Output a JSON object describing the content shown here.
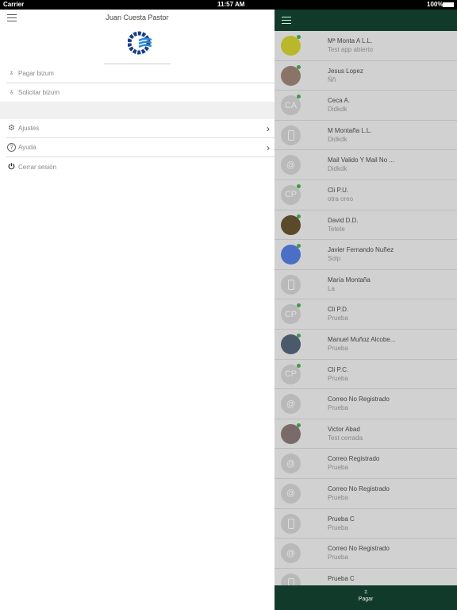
{
  "status": {
    "carrier": "Carrier",
    "time": "11:57 AM",
    "battery": "100%"
  },
  "menu": {
    "user_name": "Juan Cuesta Pastor",
    "items": [
      {
        "label": "Pagar bizum",
        "icon": "piggy-bank-icon"
      },
      {
        "label": "Solicitar bizum",
        "icon": "piggy-bank-icon"
      },
      {
        "label": "Ajustes",
        "icon": "gear-icon"
      },
      {
        "label": "Ayuda",
        "icon": "help-icon"
      },
      {
        "label": "Cerrar sesión",
        "icon": "power-icon"
      }
    ]
  },
  "colors": {
    "header": "#113a2b",
    "online": "#3d9a4a",
    "list_bg": "#d1d1d1"
  },
  "contacts": [
    {
      "name": "Mª Monta A L.L.",
      "sub": "Test app abierto",
      "avatar": "photo",
      "color": "#b8b82a",
      "online": true
    },
    {
      "name": "Jesus Lopez",
      "sub": "Ññ",
      "avatar": "photo",
      "color": "#8a7468",
      "online": true
    },
    {
      "name": "Ceca A.",
      "sub": "Didkdk",
      "avatar": "CA",
      "online": true
    },
    {
      "name": "M Montaña L.L.",
      "sub": "Didkdk",
      "avatar": "phone",
      "online": false
    },
    {
      "name": "Mail Valido Y Mail No ...",
      "sub": "Didkdk",
      "avatar": "@",
      "online": false
    },
    {
      "name": "Cli P.U.",
      "sub": "otra oreo",
      "avatar": "CP",
      "online": true
    },
    {
      "name": "David D.D.",
      "sub": "Tetete",
      "avatar": "photo",
      "color": "#5a4a2a",
      "online": true
    },
    {
      "name": "Javier Fernando Nuñez",
      "sub": "Solp",
      "avatar": "photo",
      "color": "#4a6fc4",
      "online": true
    },
    {
      "name": "María Montaña",
      "sub": "La",
      "avatar": "phone",
      "online": false
    },
    {
      "name": "Cli P.D.",
      "sub": "Prueba",
      "avatar": "CP",
      "online": true
    },
    {
      "name": "Manuel Muñoz Alcobe...",
      "sub": "Prueba",
      "avatar": "photo",
      "color": "#4a5a6a",
      "online": true
    },
    {
      "name": "Cli P.C.",
      "sub": "Prueba",
      "avatar": "CP",
      "online": true
    },
    {
      "name": "Correo No Registrado",
      "sub": "Prueba",
      "avatar": "@",
      "online": false
    },
    {
      "name": "Victor Abad",
      "sub": "Test cerrada",
      "avatar": "photo",
      "color": "#7a6a6a",
      "online": true
    },
    {
      "name": "Correo Registrado",
      "sub": "Prueba",
      "avatar": "@",
      "online": false
    },
    {
      "name": "Correo No Registrado",
      "sub": "Prueba",
      "avatar": "@",
      "online": false
    },
    {
      "name": "Prueba C",
      "sub": "Prueba",
      "avatar": "phone",
      "online": false
    },
    {
      "name": "Correo No Registrado",
      "sub": "Prueba",
      "avatar": "@",
      "online": false
    },
    {
      "name": "Prueba C",
      "sub": "",
      "avatar": "phone",
      "online": false
    }
  ],
  "footer": {
    "pay_label": "Pagar"
  }
}
